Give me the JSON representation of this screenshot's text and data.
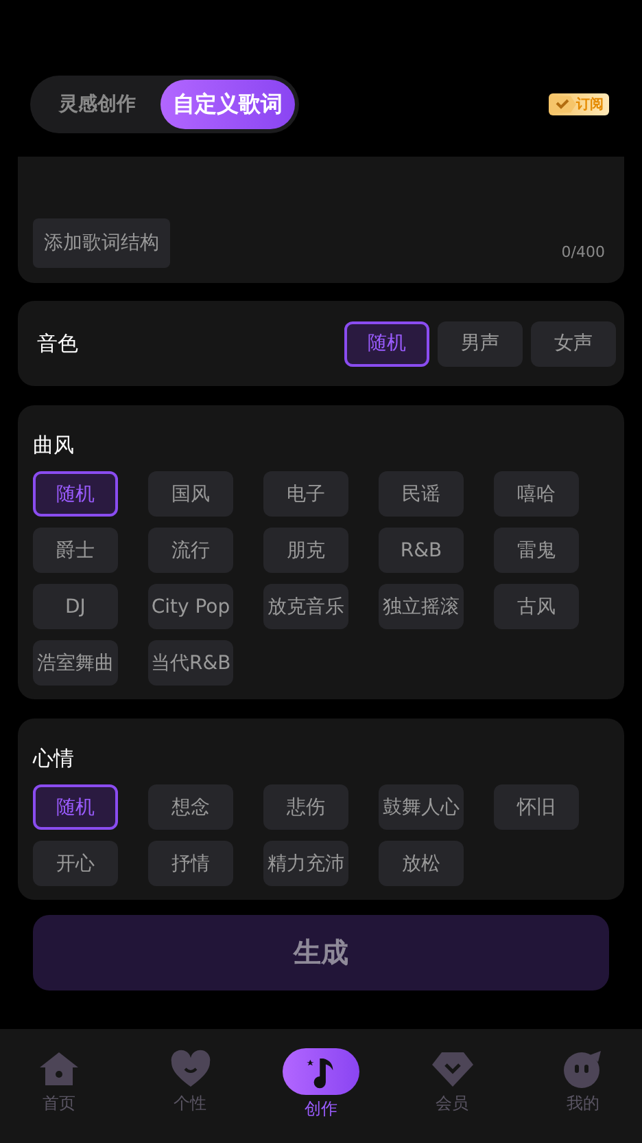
{
  "mode_tabs": [
    {
      "label": "灵感创作",
      "selected": false
    },
    {
      "label": "自定义歌词",
      "selected": true
    }
  ],
  "subscribe": {
    "label": "订阅"
  },
  "lyrics": {
    "structure_button": "添加歌词结构",
    "counter": "0/400"
  },
  "voice": {
    "title": "音色",
    "options": [
      {
        "label": "随机",
        "selected": true
      },
      {
        "label": "男声",
        "selected": false
      },
      {
        "label": "女声",
        "selected": false
      }
    ]
  },
  "style": {
    "title": "曲风",
    "options": [
      {
        "label": "随机",
        "selected": true
      },
      {
        "label": "国风",
        "selected": false
      },
      {
        "label": "电子",
        "selected": false
      },
      {
        "label": "民谣",
        "selected": false
      },
      {
        "label": "嘻哈",
        "selected": false
      },
      {
        "label": "爵士",
        "selected": false
      },
      {
        "label": "流行",
        "selected": false
      },
      {
        "label": "朋克",
        "selected": false
      },
      {
        "label": "R&B",
        "selected": false
      },
      {
        "label": "雷鬼",
        "selected": false
      },
      {
        "label": "DJ",
        "selected": false
      },
      {
        "label": "City Pop",
        "selected": false
      },
      {
        "label": "放克音乐",
        "selected": false
      },
      {
        "label": "独立摇滚",
        "selected": false
      },
      {
        "label": "古风",
        "selected": false
      },
      {
        "label": "浩室舞曲",
        "selected": false
      },
      {
        "label": "当代R&B",
        "selected": false
      }
    ]
  },
  "mood": {
    "title": "心情",
    "options": [
      {
        "label": "随机",
        "selected": true
      },
      {
        "label": "想念",
        "selected": false
      },
      {
        "label": "悲伤",
        "selected": false
      },
      {
        "label": "鼓舞人心",
        "selected": false
      },
      {
        "label": "怀旧",
        "selected": false
      },
      {
        "label": "开心",
        "selected": false
      },
      {
        "label": "抒情",
        "selected": false
      },
      {
        "label": "精力充沛",
        "selected": false
      },
      {
        "label": "放松",
        "selected": false
      }
    ]
  },
  "generate_button": {
    "label": "生成",
    "disabled": true
  },
  "bottom_nav": [
    {
      "kind": "home",
      "label": "首页",
      "selected": false
    },
    {
      "kind": "heart",
      "label": "个性",
      "selected": false
    },
    {
      "kind": "create",
      "label": "创作",
      "selected": true
    },
    {
      "kind": "diamond",
      "label": "会员",
      "selected": false
    },
    {
      "kind": "me",
      "label": "我的",
      "selected": false
    }
  ]
}
